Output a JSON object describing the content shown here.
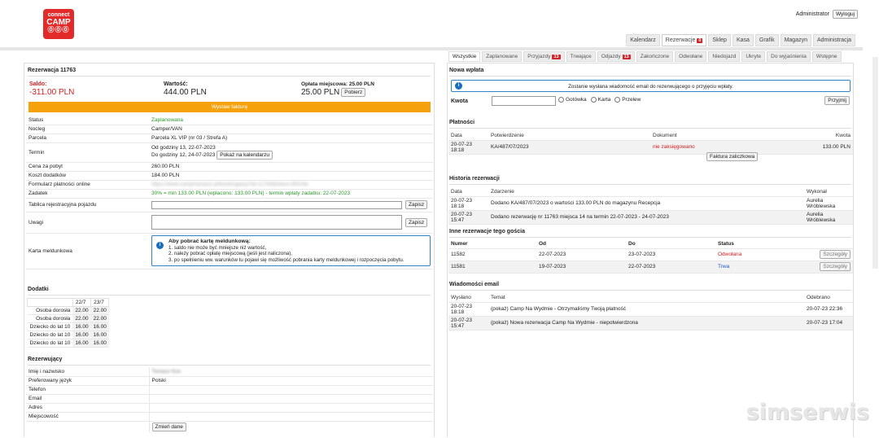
{
  "logo": {
    "line1": "connect",
    "line2": "CAMP",
    "line3": "⓪⓪⓪"
  },
  "admin": {
    "user": "Administrator",
    "logout": "Wyloguj"
  },
  "topnav": [
    {
      "label": "Kalendarz"
    },
    {
      "label": "Rezerwacje",
      "badge": "0",
      "active": true
    },
    {
      "label": "Sklep"
    },
    {
      "label": "Kasa"
    },
    {
      "label": "Grafik"
    },
    {
      "label": "Magazyn"
    },
    {
      "label": "Administracja"
    }
  ],
  "subtabs": [
    {
      "label": "Wszystkie",
      "active": true
    },
    {
      "label": "Zaplanowane"
    },
    {
      "label": "Przyjazdy",
      "badge": "13"
    },
    {
      "label": "Trwające"
    },
    {
      "label": "Odjazdy",
      "badge": "13"
    },
    {
      "label": "Zakończone"
    },
    {
      "label": "Odwołane"
    },
    {
      "label": "Niedojazd"
    },
    {
      "label": "Ukryte"
    },
    {
      "label": "Do wyjaśnienia"
    },
    {
      "label": "Wstępne"
    }
  ],
  "reservation": {
    "title": "Rezerwacja 11763",
    "saldo_label": "Saldo:",
    "saldo_value": "-311.00 PLN",
    "wartosc_label": "Wartość:",
    "wartosc_value": "444.00 PLN",
    "oplata_label": "Opłata miejscowa: 25.00 PLN",
    "oplata_value": "25.00 PLN",
    "pobierz": "Pobierz",
    "invoice_button": "Wystaw fakturę",
    "rows": {
      "status_label": "Status",
      "status_value": "Zaplanowana",
      "nocleg_label": "Nocleg",
      "nocleg_value": "Camper/VAN",
      "parcela_label": "Parcela",
      "parcela_value": "Parcela XL VIP (nr 03 / Strefa A)",
      "termin_label": "Termin",
      "termin_from": "Od godziny 13, 22-07-2023",
      "termin_to": "Do godziny 12, 24-07-2023",
      "termin_btn": "Pokaż na kalendarzu",
      "cena_label": "Cena za pobyt",
      "cena_value": "260.00 PLN",
      "koszt_label": "Koszt dodatków",
      "koszt_value": "184.00 PLN",
      "formularz_label": "Formularz płatności online",
      "formularz_value": "https://www.campmaniacs.pl/booking/pay?id=11763&token=8f2c9a",
      "zadatek_label": "Zadatek",
      "zadatek_value": "30% = min 133.00 PLN (wpłacono: 133.00 PLN) - termin wpłaty zadatku: 22-07-2023",
      "tablica_label": "Tablica rejestracyjna pojazdu",
      "zapisz1": "Zapisz",
      "uwagi_label": "Uwagi",
      "zapisz2": "Zapisz",
      "karta_label": "Karta meldunkowa",
      "karta_title": "Aby pobrać kartę meldunkową:",
      "karta_1": "1. saldo nie może być mniejsze niż wartość,",
      "karta_2": "2. należy pobrać opłatę miejscową (jeśli jest naliczona),",
      "karta_3": "3. po spełnieniu ww. warunków tu pojawi się możliwość pobrania karty meldunkowej i rozpoczęcia pobytu."
    }
  },
  "dodatki": {
    "title": "Dodatki",
    "dates": [
      "22/7",
      "23/7"
    ],
    "rows": [
      {
        "name": "Osoba dorosła",
        "v1": "22.00",
        "v2": "22.00"
      },
      {
        "name": "Osoba dorosła",
        "v1": "22.00",
        "v2": "22.00"
      },
      {
        "name": "Dziecko do lat 10",
        "v1": "16.00",
        "v2": "16.00"
      },
      {
        "name": "Dziecko do lat 10",
        "v1": "16.00",
        "v2": "16.00"
      },
      {
        "name": "Dziecko do lat 10",
        "v1": "16.00",
        "v2": "16.00"
      }
    ]
  },
  "rezerwujacy": {
    "title": "Rezerwujący",
    "imie_label": "Imię i nazwisko",
    "imie_value": "Tomasz Kon",
    "jezyk_label": "Preferowany język",
    "jezyk_value": "Polski",
    "telefon_label": "Telefon",
    "email_label": "Email",
    "adres_label": "Adres",
    "miejscowosc_label": "Miejscowość",
    "zmien": "Zmień dane"
  },
  "nowa_wplata": {
    "title": "Nowa wpłata",
    "info": "Zostanie wysłana wiadomość email do rezerwującego o przyjęciu wpłaty.",
    "kwota_label": "Kwota",
    "opt1": "Gotówka",
    "opt2": "Karta",
    "opt3": "Przelew",
    "przyjmij": "Przyjmij"
  },
  "platnosci": {
    "title": "Płatności",
    "headers": [
      "Data",
      "Potwierdzenie",
      "Dokument",
      "Kwota"
    ],
    "row": {
      "data": "20-07-23 18:18",
      "potw": "KA/487/07/2023",
      "dok": "nie zaksięgowano",
      "kwota": "133.00 PLN"
    },
    "faktura": "Faktura zaliczkowa"
  },
  "historia": {
    "title": "Historia rezerwacji",
    "headers": [
      "Data",
      "Zdarzenie",
      "Wykonał"
    ],
    "rows": [
      {
        "data": "20-07-23 18:18",
        "zd": "Dodano KA/487/07/2023 o wartości 133.00 PLN do magazynu Recepcja",
        "wyk": "Aurelia Wróblewska"
      },
      {
        "data": "20-07-23 15:47",
        "zd": "Dodano rezerwację nr 11763 miejsca 14 na termin 22-07-2023 - 24-07-2023",
        "wyk": "Aurelia Wróblewska"
      }
    ]
  },
  "inne": {
    "title": "Inne rezerwacje tego gościa",
    "headers": [
      "Numer",
      "Od",
      "Do",
      "Status"
    ],
    "rows": [
      {
        "num": "11582",
        "od": "22-07-2023",
        "do": "23-07-2023",
        "status": "Odwołana",
        "btn": "Szczegóły"
      },
      {
        "num": "11581",
        "od": "19-07-2023",
        "do": "22-07-2023",
        "status": "Trwa",
        "btn": "Szczegóły"
      }
    ]
  },
  "wiadomosci": {
    "title": "Wiadomości email",
    "headers": [
      "Wysłano",
      "Temat",
      "Odebrano"
    ],
    "rows": [
      {
        "wys": "20-07-23 18:18",
        "temat": "(pokaż) Camp Na Wydmie - Otrzymaliśmy Twoją płatność",
        "odb": "20-07-23 22:36"
      },
      {
        "wys": "20-07-23 15:47",
        "temat": "(pokaż) Nowa rezerwacja Camp Na Wydmie - niepotwierdzona",
        "odb": "20-07-23 17:04"
      }
    ]
  },
  "watermark": "simserwis"
}
